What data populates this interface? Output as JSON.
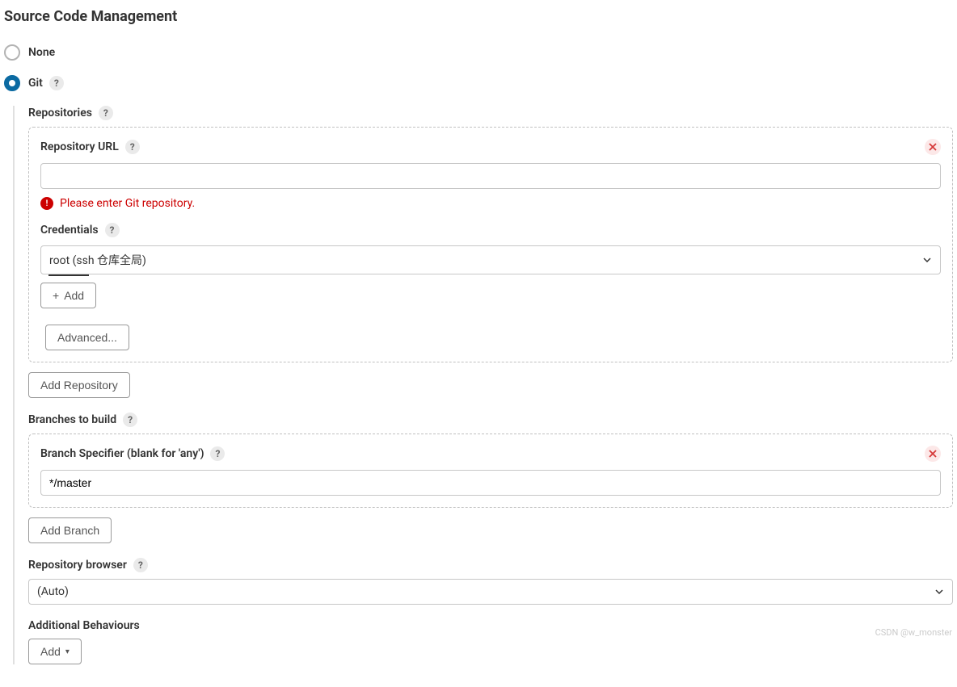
{
  "section_title": "Source Code Management",
  "scm_options": {
    "none_label": "None",
    "git_label": "Git"
  },
  "repositories": {
    "label": "Repositories",
    "url_label": "Repository URL",
    "url_value": "",
    "error_msg": "Please enter Git repository.",
    "credentials_label": "Credentials",
    "credentials_value": "root (ssh 仓库全局)",
    "add_cred_label": "Add",
    "advanced_label": "Advanced...",
    "add_repo_label": "Add Repository"
  },
  "branches": {
    "label": "Branches to build",
    "specifier_label": "Branch Specifier (blank for 'any')",
    "specifier_value": "*/master",
    "add_branch_label": "Add Branch"
  },
  "repo_browser": {
    "label": "Repository browser",
    "value": "(Auto)"
  },
  "additional": {
    "label": "Additional Behaviours",
    "add_label": "Add"
  },
  "watermark": "CSDN @w_monster"
}
